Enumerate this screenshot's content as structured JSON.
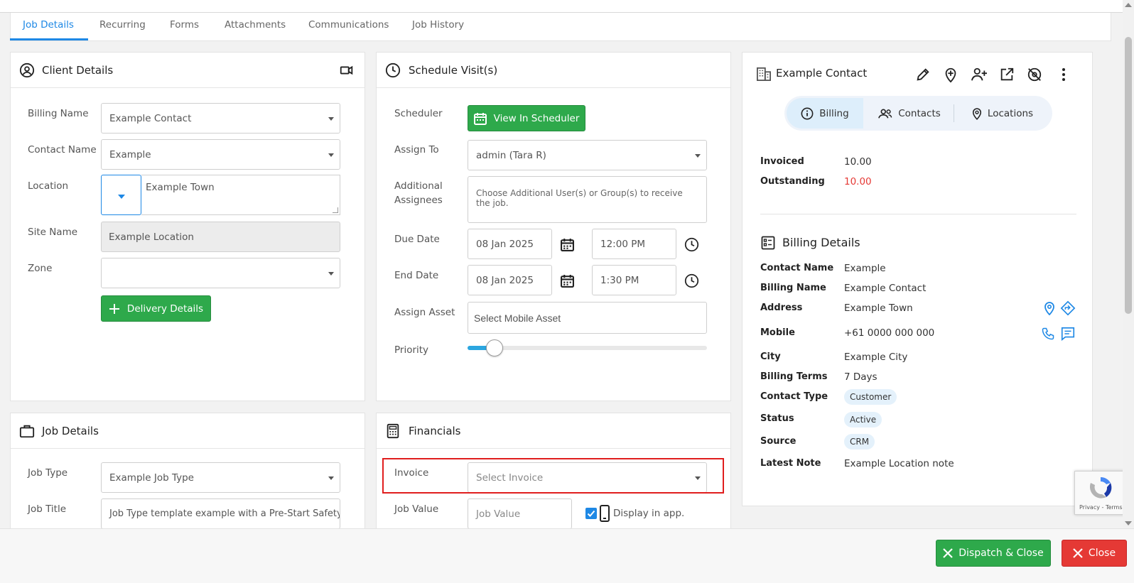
{
  "tabs": [
    "Job Details",
    "Recurring",
    "Forms",
    "Attachments",
    "Communications",
    "Job History"
  ],
  "client_details": {
    "title": "Client Details",
    "billing_name_label": "Billing Name",
    "billing_name_value": "Example Contact",
    "contact_name_label": "Contact Name",
    "contact_name_value": "Example",
    "location_label": "Location",
    "location_value": "Example Town",
    "site_name_label": "Site Name",
    "site_name_value": "Example Location",
    "zone_label": "Zone",
    "zone_value": "",
    "delivery_button": "Delivery Details"
  },
  "schedule": {
    "title": "Schedule Visit(s)",
    "scheduler_label": "Scheduler",
    "scheduler_button": "View In Scheduler",
    "assign_to_label": "Assign To",
    "assign_to_value": "admin (Tara R)",
    "additional_label_1": "Additional",
    "additional_label_2": "Assignees",
    "additional_placeholder": "Choose Additional User(s) or Group(s) to receive the job.",
    "due_date_label": "Due Date",
    "due_date_value": "08 Jan 2025",
    "due_time_value": "12:00 PM",
    "end_date_label": "End Date",
    "end_date_value": "08 Jan 2025",
    "end_time_value": "1:30 PM",
    "assign_asset_label": "Assign Asset",
    "assign_asset_placeholder": "Select Mobile Asset",
    "priority_label": "Priority",
    "priority_fraction": 0.1
  },
  "job_details": {
    "title": "Job Details",
    "job_type_label": "Job Type",
    "job_type_value": "Example Job Type",
    "job_title_label": "Job Title",
    "job_title_value": "Job Type template example with a Pre-Start Safety C"
  },
  "financials": {
    "title": "Financials",
    "invoice_label": "Invoice",
    "invoice_placeholder": "Select Invoice",
    "job_value_label": "Job Value",
    "job_value_placeholder": "Job Value",
    "display_in_app_label": "Display in app.",
    "display_in_app_checked": true
  },
  "contact_panel": {
    "title": "Example Contact",
    "subtabs": [
      "Billing",
      "Contacts",
      "Locations"
    ],
    "invoiced_label": "Invoiced",
    "invoiced_value": "10.00",
    "outstanding_label": "Outstanding",
    "outstanding_value": "10.00",
    "billing_details_title": "Billing Details",
    "rows": [
      {
        "label": "Contact Name",
        "value": "Example"
      },
      {
        "label": "Billing Name",
        "value": "Example Contact"
      },
      {
        "label": "Address",
        "value": "Example Town"
      },
      {
        "label": "Mobile",
        "value": "+61 0000 000 000"
      },
      {
        "label": "City",
        "value": "Example City"
      },
      {
        "label": "Billing Terms",
        "value": "7 Days"
      },
      {
        "label": "Contact Type",
        "value": "Customer"
      },
      {
        "label": "Status",
        "value": "Active"
      },
      {
        "label": "Source",
        "value": "CRM"
      },
      {
        "label": "Latest Note",
        "value": "Example Location note"
      }
    ]
  },
  "recaptcha": {
    "text": "Privacy - Terms"
  },
  "footer": {
    "dispatch_button": "Dispatch & Close",
    "close_button": "Close"
  },
  "colors": {
    "accent": "#1e88e5",
    "green": "#2ea94b",
    "red": "#e53935",
    "highlight": "#e01e1e"
  }
}
